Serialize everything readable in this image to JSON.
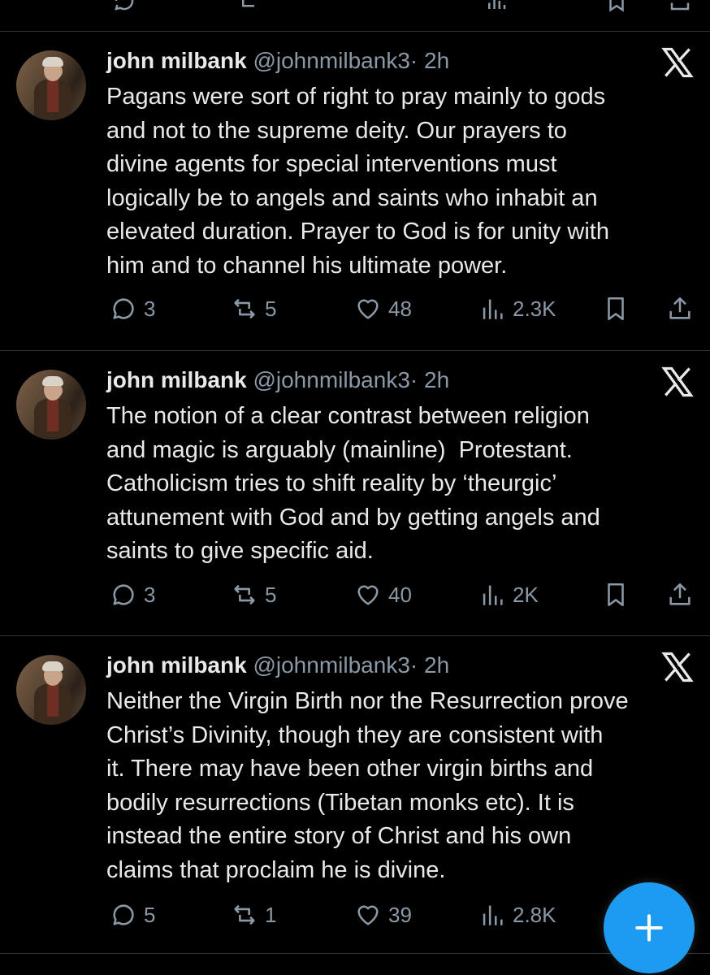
{
  "tweets": [
    {
      "name": "john milbank",
      "handle": "@johnmilbank3",
      "time": "· 2h",
      "text": "Pagans were sort of right to pray mainly to gods\nand not to the supreme deity. Our prayers to\ndivine agents for special interventions must\nlogically be to angels and saints who inhabit an\nelevated duration. Prayer to God is for unity with\nhim and to channel his ultimate power.",
      "replies": "3",
      "reposts": "5",
      "likes": "48",
      "views": "2.3K"
    },
    {
      "name": "john milbank",
      "handle": "@johnmilbank3",
      "time": "· 2h",
      "text": "The notion of a clear contrast between religion\nand magic is arguably (mainline)  Protestant.\nCatholicism tries to shift reality by ‘theurgic’\nattunement with God and by getting angels and\nsaints to give specific aid.",
      "replies": "3",
      "reposts": "5",
      "likes": "40",
      "views": "2K"
    },
    {
      "name": "john milbank",
      "handle": "@johnmilbank3",
      "time": "· 2h",
      "text": "Neither the Virgin Birth nor the Resurrection prove\nChrist’s Divinity, though they are consistent with\nit. There may have been other virgin births and\nbodily resurrections (Tibetan monks etc). It is\ninstead the entire story of Christ and his own\nclaims that proclaim he is divine.",
      "replies": "5",
      "reposts": "1",
      "likes": "39",
      "views": "2.8K"
    }
  ],
  "icons": {
    "reply": "reply-icon",
    "repost": "repost-icon",
    "like": "heart-icon",
    "views": "views-icon",
    "bookmark": "bookmark-icon",
    "share": "share-icon",
    "platform": "x-logo-icon",
    "compose": "plus-icon"
  },
  "colors": {
    "background": "#000000",
    "text": "#e7e9ea",
    "muted": "#8b98a5",
    "accent": "#1d9bf0",
    "divider": "#2f3336"
  }
}
